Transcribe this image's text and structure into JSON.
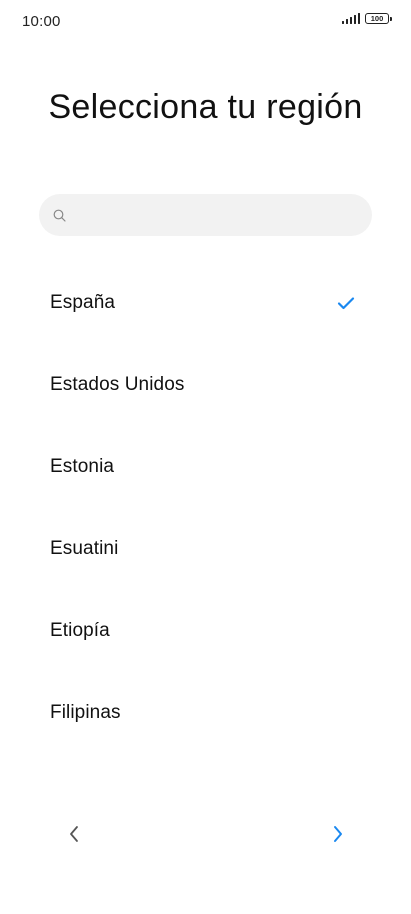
{
  "status_bar": {
    "time": "10:00",
    "battery_level": "100"
  },
  "page": {
    "title": "Selecciona tu región"
  },
  "search": {
    "value": "",
    "placeholder": ""
  },
  "regions": [
    {
      "label": "España",
      "selected": true
    },
    {
      "label": "Estados Unidos",
      "selected": false
    },
    {
      "label": "Estonia",
      "selected": false
    },
    {
      "label": "Esuatini",
      "selected": false
    },
    {
      "label": "Etiopía",
      "selected": false
    },
    {
      "label": "Filipinas",
      "selected": false
    }
  ],
  "navigation": {
    "back_icon": "chevron-left-icon",
    "next_icon": "chevron-right-icon"
  },
  "colors": {
    "accent": "#1a88f0",
    "back_arrow": "#555555",
    "search_bg": "#f2f2f2"
  }
}
